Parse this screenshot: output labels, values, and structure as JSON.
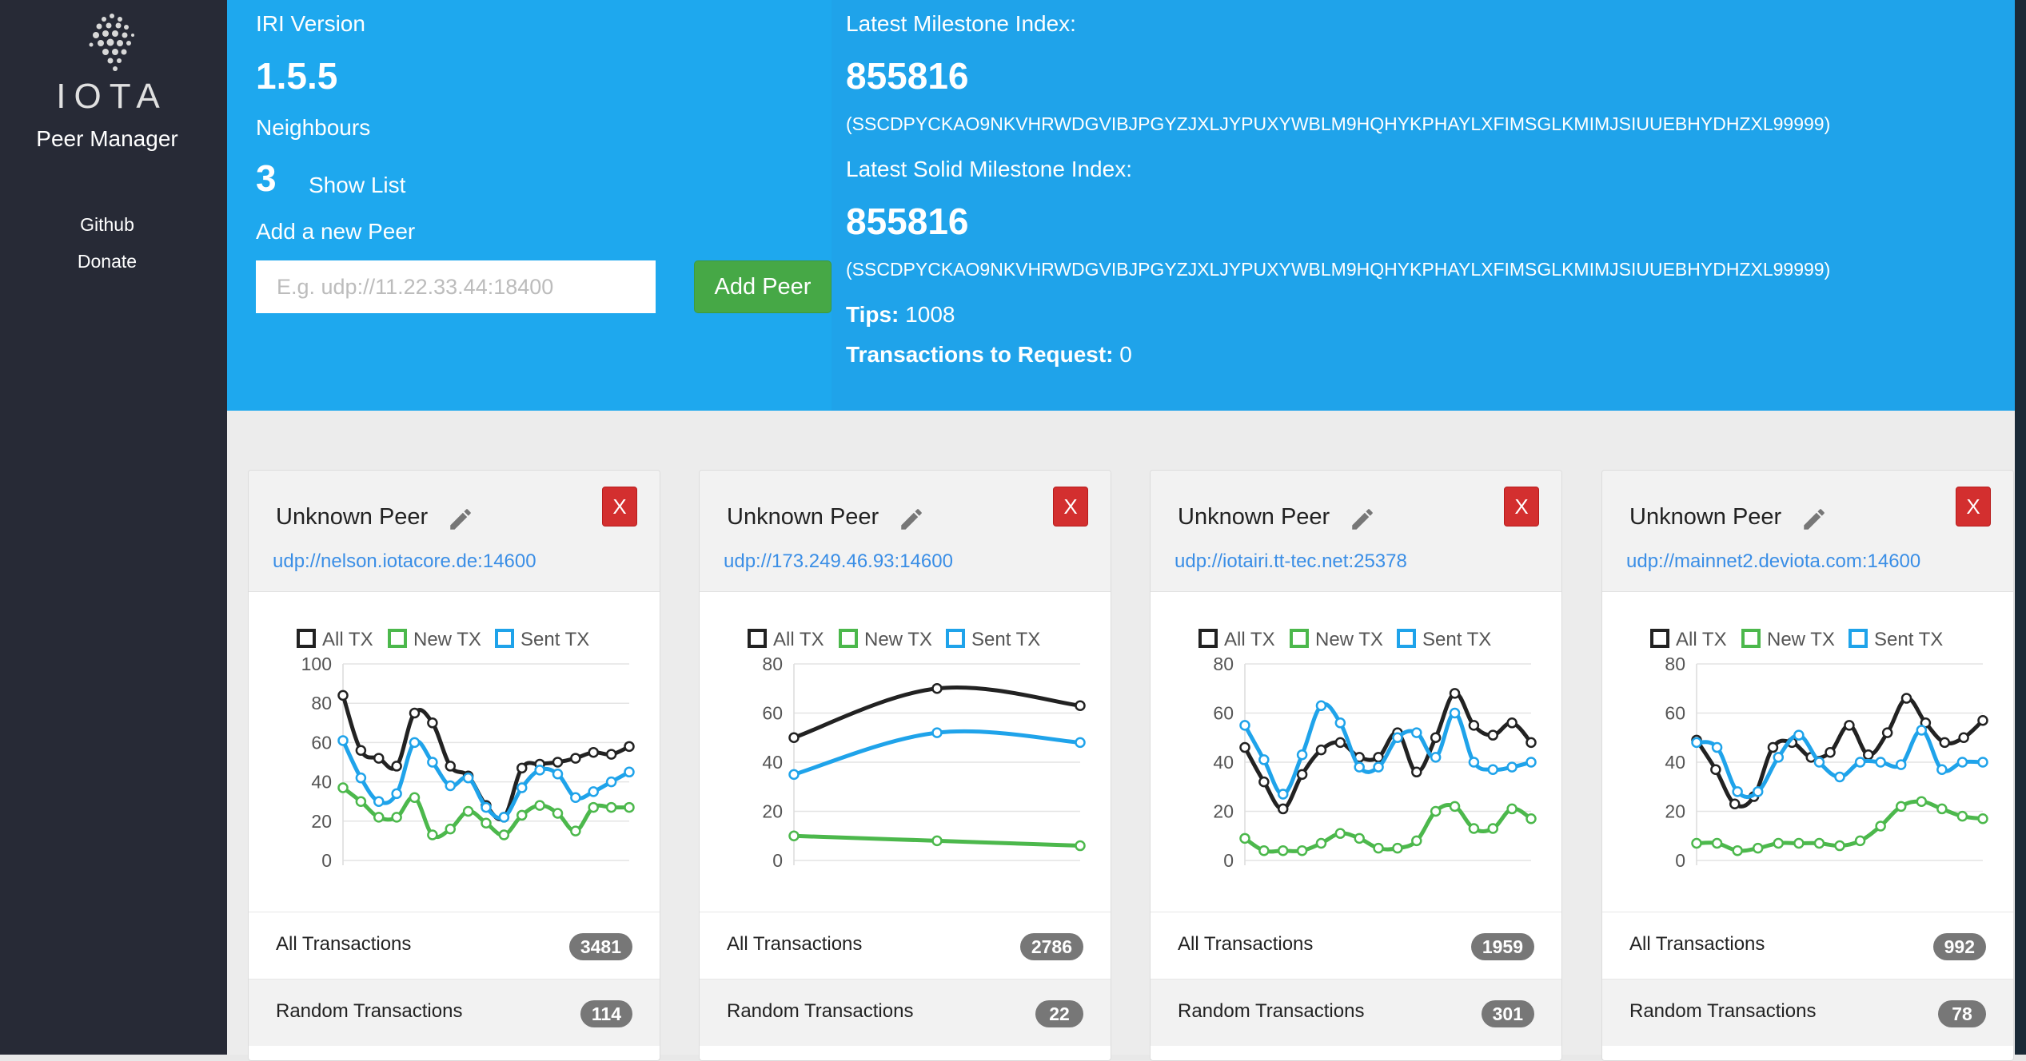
{
  "sidebar": {
    "logo_text": "IOTA",
    "title": "Peer Manager",
    "links": [
      "Github",
      "Donate"
    ]
  },
  "node": {
    "iri_version_label": "IRI Version",
    "iri_version": "1.5.5",
    "neighbours_label": "Neighbours",
    "neighbours_count": "3",
    "show_list": "Show List",
    "add_peer_label": "Add a new Peer",
    "add_peer_placeholder": "E.g. udp://11.22.33.44:18400",
    "add_peer_button": "Add Peer",
    "latest_milestone_label": "Latest Milestone Index:",
    "latest_milestone": "855816",
    "latest_milestone_hash": "(SSCDPYCKAO9NKVHRWDGVIBJPGYZJXLJYPUXYWBLM9HQHYKPHAYLXFIMSGLKMIMJSIUUEBHYDHZXL99999)",
    "latest_solid_label": "Latest Solid Milestone Index:",
    "latest_solid": "855816",
    "latest_solid_hash": "(SSCDPYCKAO9NKVHRWDGVIBJPGYZJXLJYPUXYWBLM9HQHYKPHAYLXFIMSGLKMIMJSIUUEBHYDHZXL99999)",
    "tips_label": "Tips:",
    "tips": "1008",
    "tx_to_request_label": "Transactions to Request:",
    "tx_to_request": "0"
  },
  "colors": {
    "all_tx": "#222222",
    "new_tx": "#4cb84c",
    "sent_tx": "#1fa3ea"
  },
  "peers": [
    {
      "name": "Unknown Peer",
      "url": "udp://nelson.iotacore.de:14600",
      "remove_label": "X",
      "all_transactions_label": "All Transactions",
      "all_transactions": "3481",
      "random_transactions_label": "Random Transactions",
      "random_transactions": "114"
    },
    {
      "name": "Unknown Peer",
      "url": "udp://173.249.46.93:14600",
      "remove_label": "X",
      "all_transactions_label": "All Transactions",
      "all_transactions": "2786",
      "random_transactions_label": "Random Transactions",
      "random_transactions": "22"
    },
    {
      "name": "Unknown Peer",
      "url": "udp://iotairi.tt-tec.net:25378",
      "remove_label": "X",
      "all_transactions_label": "All Transactions",
      "all_transactions": "1959",
      "random_transactions_label": "Random Transactions",
      "random_transactions": "301"
    },
    {
      "name": "Unknown Peer",
      "url": "udp://mainnet2.deviota.com:14600",
      "remove_label": "X",
      "all_transactions_label": "All Transactions",
      "all_transactions": "992",
      "random_transactions_label": "Random Transactions",
      "random_transactions": "78"
    }
  ],
  "chart_data": [
    {
      "type": "line",
      "legend": [
        "All TX",
        "New TX",
        "Sent TX"
      ],
      "legend_position": "top",
      "ylim": [
        0,
        100
      ],
      "yticks": [
        "0",
        "20",
        "40",
        "60",
        "80",
        "100"
      ],
      "series": [
        {
          "name": "All TX",
          "values": [
            84,
            56,
            52,
            48,
            75,
            70,
            48,
            43,
            28,
            22,
            47,
            49,
            50,
            52,
            55,
            54,
            58
          ]
        },
        {
          "name": "New TX",
          "values": [
            37,
            30,
            22,
            22,
            32,
            13,
            16,
            25,
            19,
            13,
            23,
            28,
            24,
            15,
            27,
            27,
            27
          ]
        },
        {
          "name": "Sent TX",
          "values": [
            61,
            42,
            30,
            34,
            60,
            50,
            38,
            42,
            27,
            22,
            37,
            46,
            44,
            32,
            35,
            40,
            45
          ]
        }
      ]
    },
    {
      "type": "line",
      "legend": [
        "All TX",
        "New TX",
        "Sent TX"
      ],
      "legend_position": "top",
      "ylim": [
        0,
        80
      ],
      "yticks": [
        "0",
        "20",
        "40",
        "60",
        "80"
      ],
      "series": [
        {
          "name": "All TX",
          "values": [
            50,
            70,
            63
          ]
        },
        {
          "name": "New TX",
          "values": [
            10,
            8,
            6
          ]
        },
        {
          "name": "Sent TX",
          "values": [
            35,
            52,
            48
          ]
        }
      ]
    },
    {
      "type": "line",
      "legend": [
        "All TX",
        "New TX",
        "Sent TX"
      ],
      "legend_position": "top",
      "ylim": [
        0,
        80
      ],
      "yticks": [
        "0",
        "20",
        "40",
        "60",
        "80"
      ],
      "series": [
        {
          "name": "All TX",
          "values": [
            46,
            32,
            21,
            35,
            45,
            48,
            42,
            42,
            52,
            36,
            50,
            68,
            55,
            51,
            56,
            48
          ]
        },
        {
          "name": "New TX",
          "values": [
            9,
            4,
            4,
            4,
            7,
            11,
            9,
            5,
            5,
            8,
            20,
            22,
            13,
            13,
            21,
            17
          ]
        },
        {
          "name": "Sent TX",
          "values": [
            55,
            41,
            27,
            43,
            63,
            56,
            38,
            38,
            50,
            52,
            42,
            60,
            40,
            37,
            38,
            40
          ]
        }
      ]
    },
    {
      "type": "line",
      "legend": [
        "All TX",
        "New TX",
        "Sent TX"
      ],
      "legend_position": "top",
      "ylim": [
        0,
        80
      ],
      "yticks": [
        "0",
        "20",
        "40",
        "60",
        "80"
      ],
      "series": [
        {
          "name": "All TX",
          "values": [
            49,
            37,
            23,
            26,
            46,
            48,
            42,
            44,
            55,
            43,
            52,
            66,
            56,
            48,
            50,
            57
          ]
        },
        {
          "name": "New TX",
          "values": [
            7,
            7,
            4,
            5,
            7,
            7,
            7,
            6,
            8,
            14,
            22,
            24,
            21,
            18,
            17
          ]
        },
        {
          "name": "Sent TX",
          "values": [
            48,
            46,
            28,
            28,
            42,
            51,
            40,
            34,
            40,
            40,
            39,
            53,
            37,
            40,
            40
          ]
        }
      ]
    }
  ]
}
